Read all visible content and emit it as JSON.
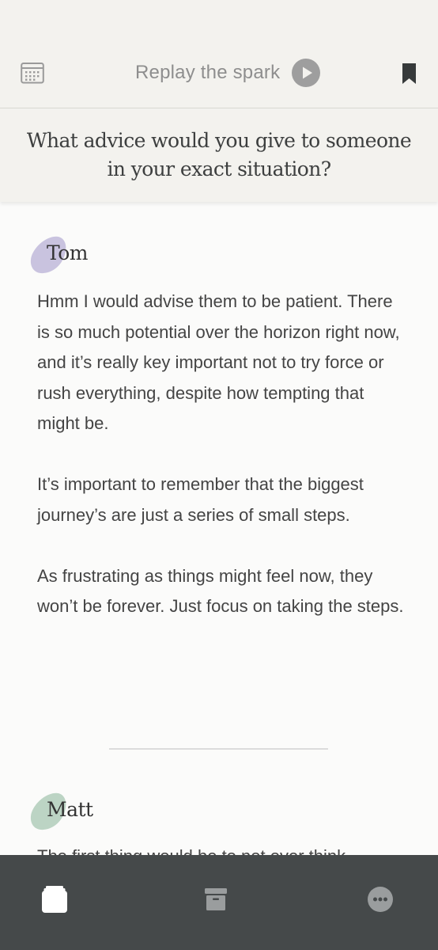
{
  "header": {
    "replay_label": "Replay the spark",
    "icons": [
      "calendar-icon",
      "play-icon",
      "bookmark-icon"
    ]
  },
  "question": {
    "text": "What advice would you give to someone in your exact situation?"
  },
  "answers": [
    {
      "author": "Tom",
      "blob_color": "#c9c3df",
      "paragraphs": [
        "Hmm I would advise them to be patient. There is so much potential over the horizon right now, and it’s really key important not to try force or rush everything, despite how tempting that might be.",
        "It’s important to remember that the biggest journey’s are just a series of small steps.",
        "As frustrating as things might feel now, they won’t be forever. Just focus on taking the steps."
      ]
    },
    {
      "author": "Matt",
      "blob_color": "#bcd4c4",
      "paragraphs": [
        "The first thing would be to not over think"
      ]
    }
  ],
  "bottom_nav": {
    "items": [
      "cards-icon",
      "archive-icon",
      "more-icon"
    ]
  },
  "colors": {
    "header_bg": "#f3f2ee",
    "body_bg": "#fbfbfa",
    "nav_bg": "#45494a"
  }
}
